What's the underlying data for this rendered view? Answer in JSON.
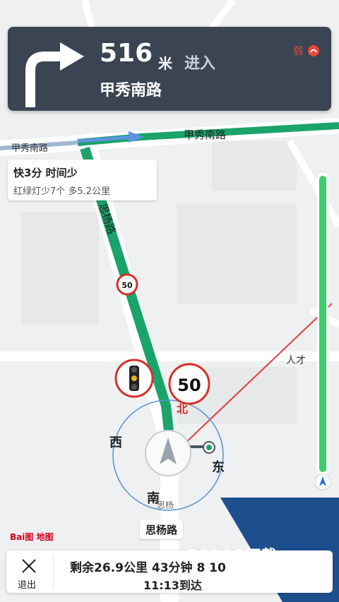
{
  "nav": {
    "distance": "516",
    "unit": "米",
    "action": "进入",
    "road": "甲秀南路",
    "signal": "弱"
  },
  "route_tip": {
    "title": "快3分 时间少",
    "subtitle": "红绿灯少7个 多5.2公里"
  },
  "map": {
    "road_top_label": "甲秀南路",
    "road_top_left_label": "甲秀南路",
    "road_vertical_label": "思杨路",
    "road_right_label": "人才",
    "speed_limit_small": "50",
    "speed_limit_big": "50",
    "compass": {
      "north": "北",
      "south": "南",
      "west": "西",
      "east": "东"
    },
    "south_road_chars": "思杨",
    "current_road": "思杨路",
    "brand": "Bai图 地图"
  },
  "bottom": {
    "exit": "退出",
    "remaining": "剩余26.9公里 43分钟 8 10",
    "arrival": "11:13到达"
  },
  "watermark": "PCPOP下载",
  "colors": {
    "route": "#1aa36a",
    "panel": "#3a4452",
    "accent": "#e8473a",
    "progress": "#3ccf6b"
  }
}
